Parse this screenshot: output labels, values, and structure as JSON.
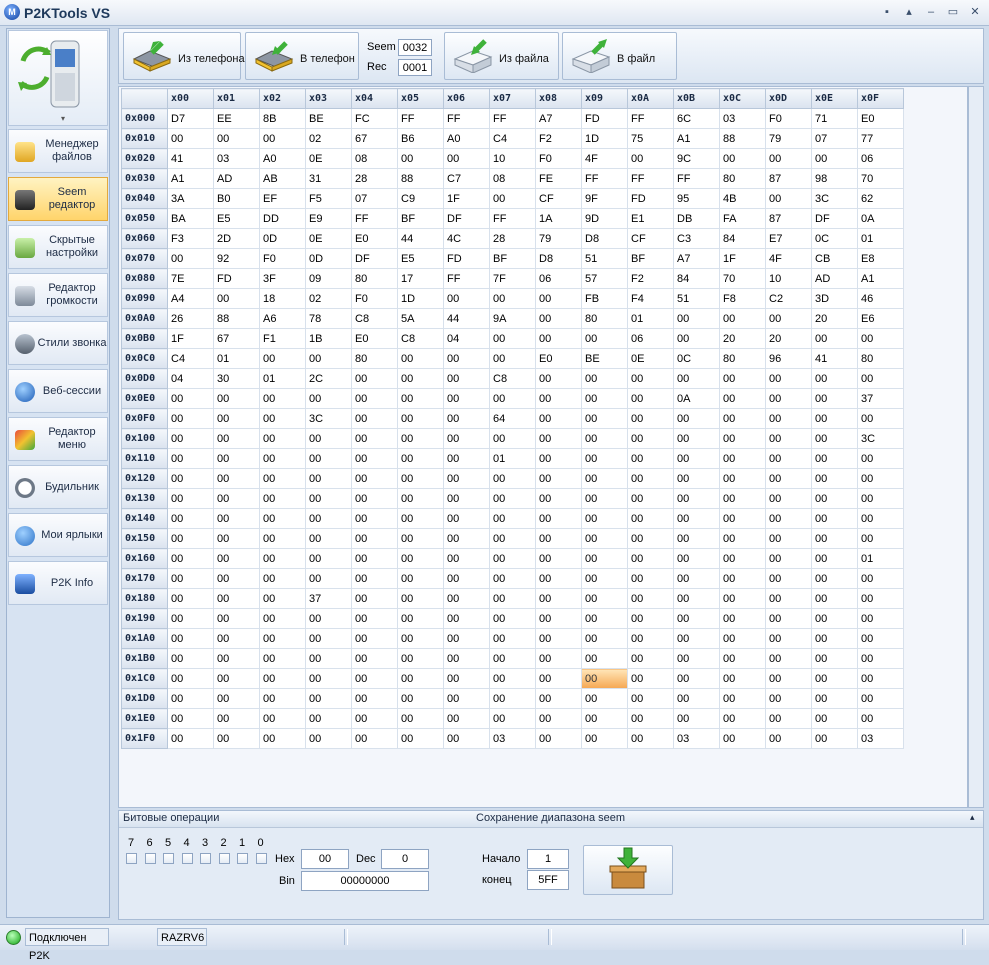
{
  "window": {
    "title": "P2KTools VS",
    "logo_letter": "M",
    "controls": [
      "▪",
      "▴",
      "–",
      "▭",
      "✕"
    ]
  },
  "sidebar": {
    "items": [
      {
        "label": "Менеджер файлов",
        "icon": "file-manager-icon"
      },
      {
        "label": "Seem редактор",
        "icon": "seem-editor-icon",
        "active": true
      },
      {
        "label": "Скрытые настройки",
        "icon": "hidden-settings-icon"
      },
      {
        "label": "Редактор громкости",
        "icon": "volume-editor-icon"
      },
      {
        "label": "Стили звонка",
        "icon": "ring-styles-icon"
      },
      {
        "label": "Веб-сессии",
        "icon": "web-sessions-icon"
      },
      {
        "label": "Редактор меню",
        "icon": "menu-editor-icon"
      },
      {
        "label": "Будильник",
        "icon": "alarm-icon"
      },
      {
        "label": "Мои ярлыки",
        "icon": "shortcuts-icon"
      },
      {
        "label": "P2K Info",
        "icon": "p2k-info-icon"
      }
    ]
  },
  "toolbar": {
    "from_phone": "Из телефона",
    "to_phone": "В телефон",
    "seem_label": "Seem",
    "seem_value": "0032",
    "rec_label": "Rec",
    "rec_value": "0001",
    "from_file": "Из файла",
    "to_file": "В файл"
  },
  "grid": {
    "columns": [
      "x00",
      "x01",
      "x02",
      "x03",
      "x04",
      "x05",
      "x06",
      "x07",
      "x08",
      "x09",
      "x0A",
      "x0B",
      "x0C",
      "x0D",
      "x0E",
      "x0F"
    ],
    "selected_cell": {
      "row": 28,
      "col": 9
    },
    "rows": [
      {
        "addr": "0x000",
        "cells": [
          "D7",
          "EE",
          "8B",
          "BE",
          "FC",
          "FF",
          "FF",
          "FF",
          "A7",
          "FD",
          "FF",
          "6C",
          "03",
          "F0",
          "71",
          "E0"
        ]
      },
      {
        "addr": "0x010",
        "cells": [
          "00",
          "00",
          "00",
          "02",
          "67",
          "B6",
          "A0",
          "C4",
          "F2",
          "1D",
          "75",
          "A1",
          "88",
          "79",
          "07",
          "77"
        ]
      },
      {
        "addr": "0x020",
        "cells": [
          "41",
          "03",
          "A0",
          "0E",
          "08",
          "00",
          "00",
          "10",
          "F0",
          "4F",
          "00",
          "9C",
          "00",
          "00",
          "00",
          "06"
        ]
      },
      {
        "addr": "0x030",
        "cells": [
          "A1",
          "AD",
          "AB",
          "31",
          "28",
          "88",
          "C7",
          "08",
          "FE",
          "FF",
          "FF",
          "FF",
          "80",
          "87",
          "98",
          "70"
        ]
      },
      {
        "addr": "0x040",
        "cells": [
          "3A",
          "B0",
          "EF",
          "F5",
          "07",
          "C9",
          "1F",
          "00",
          "CF",
          "9F",
          "FD",
          "95",
          "4B",
          "00",
          "3C",
          "62"
        ]
      },
      {
        "addr": "0x050",
        "cells": [
          "BA",
          "E5",
          "DD",
          "E9",
          "FF",
          "BF",
          "DF",
          "FF",
          "1A",
          "9D",
          "E1",
          "DB",
          "FA",
          "87",
          "DF",
          "0A"
        ]
      },
      {
        "addr": "0x060",
        "cells": [
          "F3",
          "2D",
          "0D",
          "0E",
          "E0",
          "44",
          "4C",
          "28",
          "79",
          "D8",
          "CF",
          "C3",
          "84",
          "E7",
          "0C",
          "01"
        ]
      },
      {
        "addr": "0x070",
        "cells": [
          "00",
          "92",
          "F0",
          "0D",
          "DF",
          "E5",
          "FD",
          "BF",
          "D8",
          "51",
          "BF",
          "A7",
          "1F",
          "4F",
          "CB",
          "E8"
        ]
      },
      {
        "addr": "0x080",
        "cells": [
          "7E",
          "FD",
          "3F",
          "09",
          "80",
          "17",
          "FF",
          "7F",
          "06",
          "57",
          "F2",
          "84",
          "70",
          "10",
          "AD",
          "A1"
        ]
      },
      {
        "addr": "0x090",
        "cells": [
          "A4",
          "00",
          "18",
          "02",
          "F0",
          "1D",
          "00",
          "00",
          "00",
          "FB",
          "F4",
          "51",
          "F8",
          "C2",
          "3D",
          "46"
        ]
      },
      {
        "addr": "0x0A0",
        "cells": [
          "26",
          "88",
          "A6",
          "78",
          "C8",
          "5A",
          "44",
          "9A",
          "00",
          "80",
          "01",
          "00",
          "00",
          "00",
          "20",
          "E6"
        ]
      },
      {
        "addr": "0x0B0",
        "cells": [
          "1F",
          "67",
          "F1",
          "1B",
          "E0",
          "C8",
          "04",
          "00",
          "00",
          "00",
          "06",
          "00",
          "20",
          "20",
          "00",
          "00"
        ]
      },
      {
        "addr": "0x0C0",
        "cells": [
          "C4",
          "01",
          "00",
          "00",
          "80",
          "00",
          "00",
          "00",
          "E0",
          "BE",
          "0E",
          "0C",
          "80",
          "96",
          "41",
          "80"
        ]
      },
      {
        "addr": "0x0D0",
        "cells": [
          "04",
          "30",
          "01",
          "2C",
          "00",
          "00",
          "00",
          "C8",
          "00",
          "00",
          "00",
          "00",
          "00",
          "00",
          "00",
          "00"
        ]
      },
      {
        "addr": "0x0E0",
        "cells": [
          "00",
          "00",
          "00",
          "00",
          "00",
          "00",
          "00",
          "00",
          "00",
          "00",
          "00",
          "0A",
          "00",
          "00",
          "00",
          "37"
        ]
      },
      {
        "addr": "0x0F0",
        "cells": [
          "00",
          "00",
          "00",
          "3C",
          "00",
          "00",
          "00",
          "64",
          "00",
          "00",
          "00",
          "00",
          "00",
          "00",
          "00",
          "00"
        ]
      },
      {
        "addr": "0x100",
        "cells": [
          "00",
          "00",
          "00",
          "00",
          "00",
          "00",
          "00",
          "00",
          "00",
          "00",
          "00",
          "00",
          "00",
          "00",
          "00",
          "3C"
        ]
      },
      {
        "addr": "0x110",
        "cells": [
          "00",
          "00",
          "00",
          "00",
          "00",
          "00",
          "00",
          "01",
          "00",
          "00",
          "00",
          "00",
          "00",
          "00",
          "00",
          "00"
        ]
      },
      {
        "addr": "0x120",
        "cells": [
          "00",
          "00",
          "00",
          "00",
          "00",
          "00",
          "00",
          "00",
          "00",
          "00",
          "00",
          "00",
          "00",
          "00",
          "00",
          "00"
        ]
      },
      {
        "addr": "0x130",
        "cells": [
          "00",
          "00",
          "00",
          "00",
          "00",
          "00",
          "00",
          "00",
          "00",
          "00",
          "00",
          "00",
          "00",
          "00",
          "00",
          "00"
        ]
      },
      {
        "addr": "0x140",
        "cells": [
          "00",
          "00",
          "00",
          "00",
          "00",
          "00",
          "00",
          "00",
          "00",
          "00",
          "00",
          "00",
          "00",
          "00",
          "00",
          "00"
        ]
      },
      {
        "addr": "0x150",
        "cells": [
          "00",
          "00",
          "00",
          "00",
          "00",
          "00",
          "00",
          "00",
          "00",
          "00",
          "00",
          "00",
          "00",
          "00",
          "00",
          "00"
        ]
      },
      {
        "addr": "0x160",
        "cells": [
          "00",
          "00",
          "00",
          "00",
          "00",
          "00",
          "00",
          "00",
          "00",
          "00",
          "00",
          "00",
          "00",
          "00",
          "00",
          "01"
        ]
      },
      {
        "addr": "0x170",
        "cells": [
          "00",
          "00",
          "00",
          "00",
          "00",
          "00",
          "00",
          "00",
          "00",
          "00",
          "00",
          "00",
          "00",
          "00",
          "00",
          "00"
        ]
      },
      {
        "addr": "0x180",
        "cells": [
          "00",
          "00",
          "00",
          "37",
          "00",
          "00",
          "00",
          "00",
          "00",
          "00",
          "00",
          "00",
          "00",
          "00",
          "00",
          "00"
        ]
      },
      {
        "addr": "0x190",
        "cells": [
          "00",
          "00",
          "00",
          "00",
          "00",
          "00",
          "00",
          "00",
          "00",
          "00",
          "00",
          "00",
          "00",
          "00",
          "00",
          "00"
        ]
      },
      {
        "addr": "0x1A0",
        "cells": [
          "00",
          "00",
          "00",
          "00",
          "00",
          "00",
          "00",
          "00",
          "00",
          "00",
          "00",
          "00",
          "00",
          "00",
          "00",
          "00"
        ]
      },
      {
        "addr": "0x1B0",
        "cells": [
          "00",
          "00",
          "00",
          "00",
          "00",
          "00",
          "00",
          "00",
          "00",
          "00",
          "00",
          "00",
          "00",
          "00",
          "00",
          "00"
        ]
      },
      {
        "addr": "0x1C0",
        "cells": [
          "00",
          "00",
          "00",
          "00",
          "00",
          "00",
          "00",
          "00",
          "00",
          "00",
          "00",
          "00",
          "00",
          "00",
          "00",
          "00"
        ]
      },
      {
        "addr": "0x1D0",
        "cells": [
          "00",
          "00",
          "00",
          "00",
          "00",
          "00",
          "00",
          "00",
          "00",
          "00",
          "00",
          "00",
          "00",
          "00",
          "00",
          "00"
        ]
      },
      {
        "addr": "0x1E0",
        "cells": [
          "00",
          "00",
          "00",
          "00",
          "00",
          "00",
          "00",
          "00",
          "00",
          "00",
          "00",
          "00",
          "00",
          "00",
          "00",
          "00"
        ]
      },
      {
        "addr": "0x1F0",
        "cells": [
          "00",
          "00",
          "00",
          "00",
          "00",
          "00",
          "00",
          "03",
          "00",
          "00",
          "00",
          "03",
          "00",
          "00",
          "00",
          "03"
        ]
      }
    ]
  },
  "bit_ops": {
    "title": "Битовые операции",
    "bits": [
      "7",
      "6",
      "5",
      "4",
      "3",
      "2",
      "1",
      "0"
    ],
    "hex_label": "Hex",
    "hex_value": "00",
    "dec_label": "Dec",
    "dec_value": "0",
    "bin_label": "Bin",
    "bin_value": "00000000"
  },
  "range_save": {
    "title": "Сохранение диапазона seem",
    "start_label": "Начало",
    "start_value": "1",
    "end_label": "конец",
    "end_value": "5FF",
    "collapse_glyph": "▴"
  },
  "status": {
    "connection": "Подключен P2K",
    "model": "RAZRV6"
  },
  "colors": {
    "accent": "#ffd46b",
    "selected_cell": "#f5a752",
    "led": "#14a514"
  }
}
